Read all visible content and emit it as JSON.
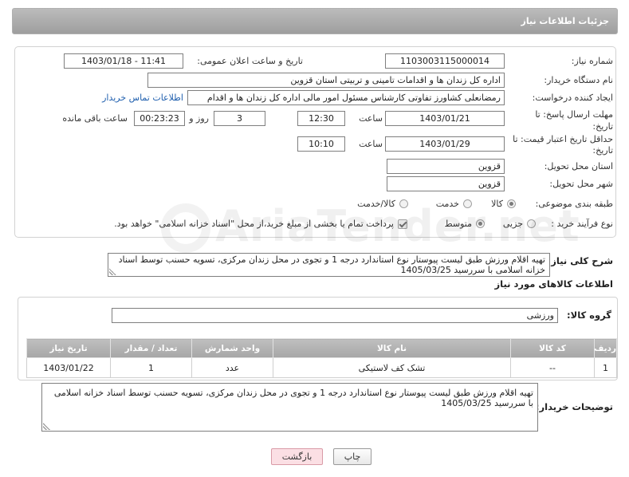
{
  "theme": {
    "header_bg": "#a8a8a8",
    "link": "#1f5fae",
    "back_button_bg": "#fbdfe4",
    "table_header_bg": "#afafaf"
  },
  "header": {
    "title": "جزئیات اطلاعات نیاز"
  },
  "watermark": "AriaTender.net",
  "form": {
    "need_number": {
      "label": "شماره نیاز:",
      "value": "1103003115000014"
    },
    "announce": {
      "label": "تاریخ و ساعت اعلان عمومی:",
      "value": "1403/01/18 - 11:41"
    },
    "buyer_org": {
      "label": "نام دستگاه خریدار:",
      "value": "اداره کل زندان ها و اقدامات تامینی و تربیتی استان قزوین"
    },
    "requester": {
      "label": "ایجاد کننده درخواست:",
      "value": "رمضانعلی کشاورز تفاوتی کارشناس مسئول امور مالی  اداره کل زندان ها و اقدام",
      "contact_link": "اطلاعات تماس خریدار"
    },
    "deadline": {
      "label_line1": "مهلت ارسال پاسخ: تا",
      "label_line2": "تاریخ:",
      "date": "1403/01/21",
      "time_label": "ساعت",
      "time": "12:30",
      "days": "3",
      "days_label": "روز و",
      "remaining": "00:23:23",
      "remaining_label": "ساعت باقی مانده"
    },
    "price_validity": {
      "label_line1": "حداقل تاریخ اعتبار قیمت: تا",
      "label_line2": "تاریخ:",
      "date": "1403/01/29",
      "time_label": "ساعت",
      "time": "10:10"
    },
    "province": {
      "label": "استان محل تحویل:",
      "value": "قزوین"
    },
    "city": {
      "label": "شهر محل تحویل:",
      "value": "قزوین"
    },
    "category": {
      "label": "طبقه بندی موضوعی:",
      "options": [
        {
          "label": "کالا",
          "selected": true
        },
        {
          "label": "خدمت",
          "selected": false
        },
        {
          "label": "کالا/خدمت",
          "selected": false
        }
      ]
    },
    "process": {
      "label": "نوع فرآیند خرید :",
      "options": [
        {
          "label": "جزیی",
          "selected": false
        },
        {
          "label": "متوسط",
          "selected": true
        }
      ],
      "treasury": {
        "label": "پرداخت تمام یا بخشی از مبلغ خرید،از محل \"اسناد خزانه اسلامی\" خواهد بود.",
        "checked": true
      }
    }
  },
  "description": {
    "label": "شرح کلی نیاز:",
    "value": "تهیه اقلام ورزش طبق لیست پیوستار نوع استاندارد درجه 1 و تجوی در محل زندان مرکزی، تسویه حسنب توسط اسناد خزانه اسلامی با سررسید 1405/03/25"
  },
  "goods": {
    "heading": "اطلاعات کالاهای مورد نیاز",
    "group_label": "گروه کالا:",
    "group_value": "ورزشی",
    "columns": [
      "ردیف",
      "کد کالا",
      "نام کالا",
      "واحد شمارش",
      "تعداد / مقدار",
      "تاریخ نیاز"
    ],
    "rows": [
      {
        "row_no": "1",
        "code": "--",
        "name": "تشک کف لاستیکی",
        "unit": "عدد",
        "qty": "1",
        "need_date": "1403/01/22"
      }
    ]
  },
  "buyer_notes": {
    "label": "توضیحات خریدار:",
    "value": "تهیه اقلام ورزش طبق لیست پیوستار نوع استاندارد درجه 1 و تجوی در محل زندان مرکزی، تسویه حسنب توسط اسناد خزانه اسلامی با سررسید 1405/03/25"
  },
  "buttons": {
    "print": "چاپ",
    "back": "بازگشت"
  }
}
